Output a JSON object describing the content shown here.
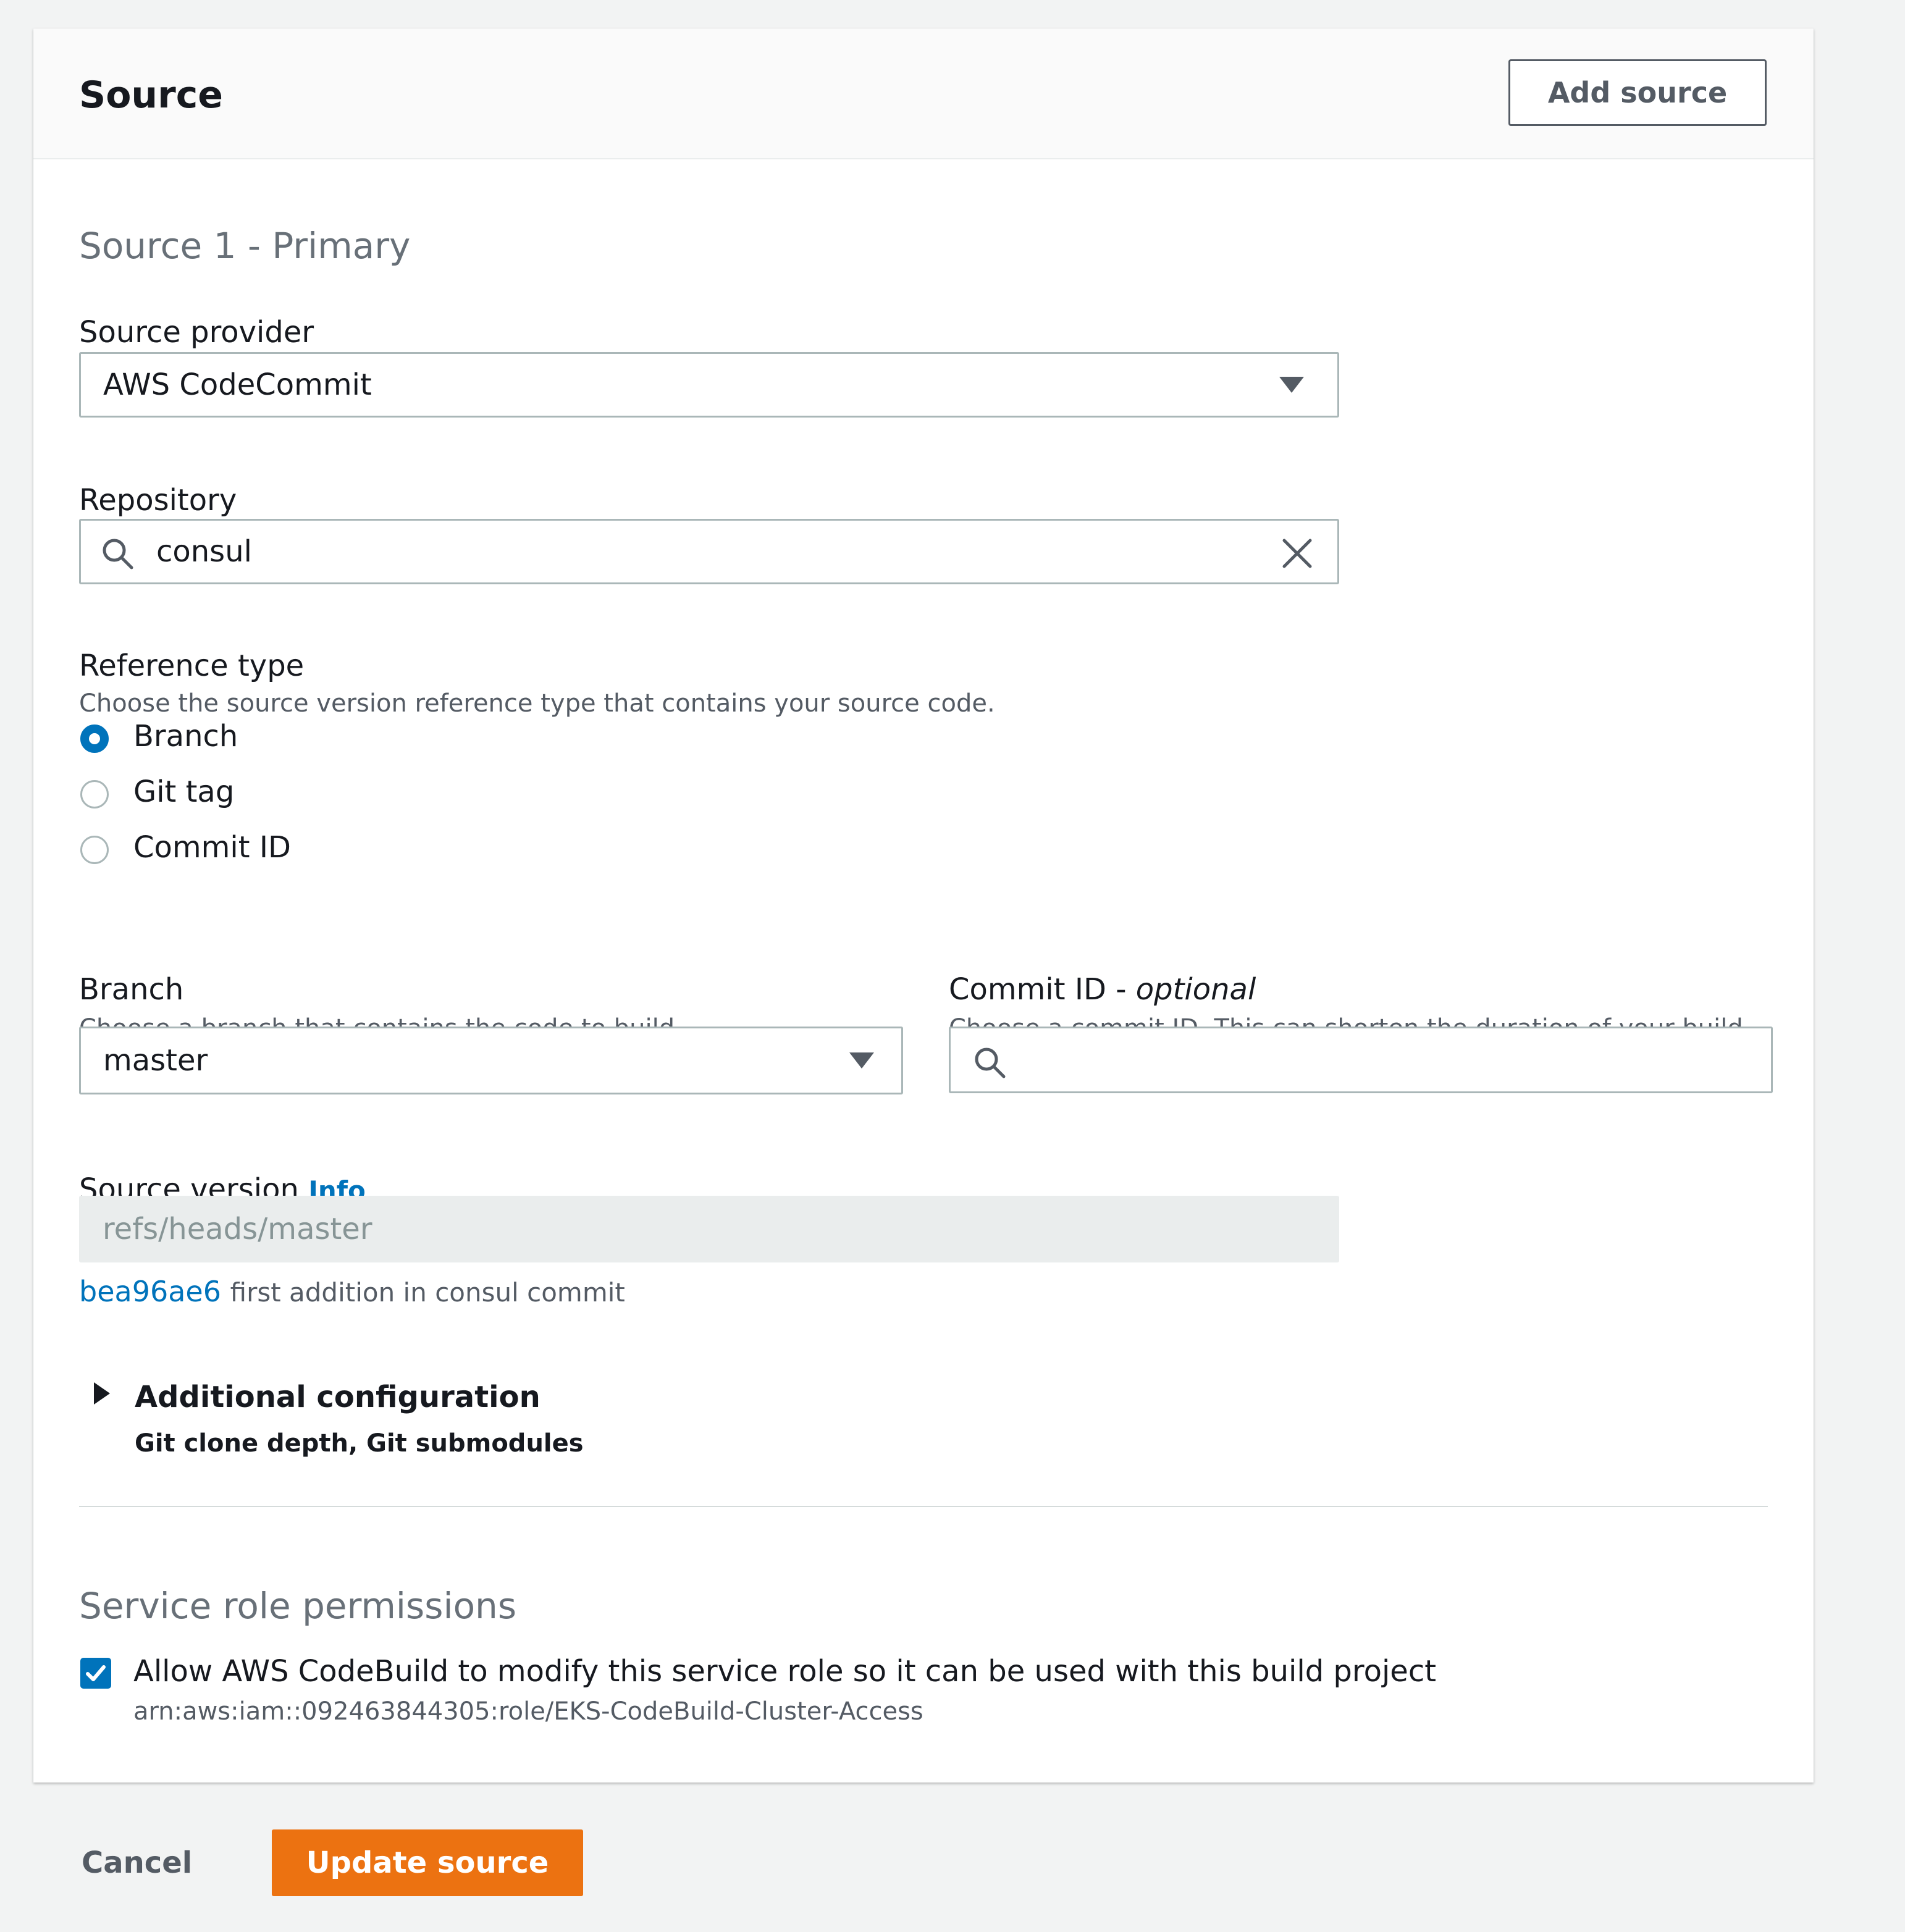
{
  "source_panel": {
    "title": "Source",
    "add_source_label": "Add source"
  },
  "primary_source": {
    "heading": "Source 1 - Primary",
    "source_provider": {
      "label": "Source provider",
      "selected": "AWS CodeCommit"
    },
    "repository": {
      "label": "Repository",
      "value": "consul"
    },
    "reference_type": {
      "label": "Reference type",
      "description": "Choose the source version reference type that contains your source code.",
      "options": [
        "Branch",
        "Git tag",
        "Commit ID"
      ],
      "selected": "Branch"
    },
    "branch": {
      "label": "Branch",
      "description": "Choose a branch that contains the code to build.",
      "selected": "master"
    },
    "commit_id": {
      "label": "Commit ID - ",
      "label_optional": "optional",
      "description": "Choose a commit ID. This can shorten the duration of your build.",
      "value": ""
    },
    "source_version": {
      "label": "Source version",
      "info_link": "Info",
      "value": "refs/heads/master",
      "commit_hash": "bea96ae6",
      "commit_message": "first addition in consul commit"
    },
    "additional_configuration": {
      "title": "Additional configuration",
      "subtitle": "Git clone depth, Git submodules",
      "expanded": false
    }
  },
  "service_role": {
    "heading": "Service role permissions",
    "checkbox_label": "Allow AWS CodeBuild to modify this service role so it can be used with this build project",
    "checked": true,
    "role_arn": "arn:aws:iam::092463844305:role/EKS-CodeBuild-Cluster-Access"
  },
  "footer": {
    "cancel_label": "Cancel",
    "submit_label": "Update source"
  },
  "colors": {
    "primary_button": "#ec7211",
    "link": "#0073bb",
    "page_background": "#f2f3f3"
  }
}
